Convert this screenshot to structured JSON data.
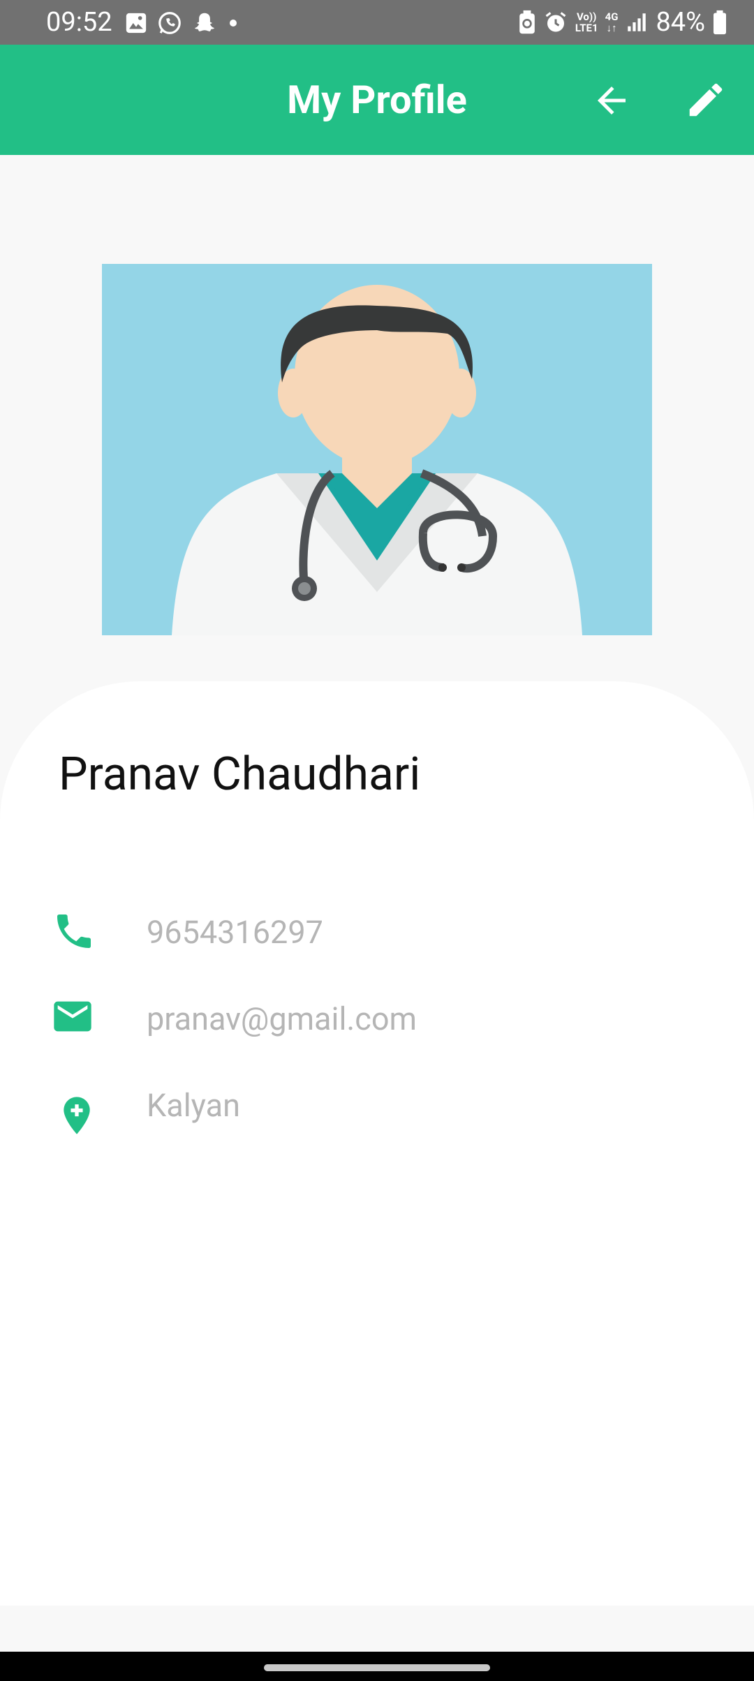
{
  "status_bar": {
    "time": "09:52",
    "network_top": "Vo))",
    "network_bottom": "LTE1",
    "network_type": "4G",
    "battery_percent": "84%",
    "icons": [
      "gallery-icon",
      "whatsapp-icon",
      "snapchat-icon",
      "dot-icon",
      "battery-saver-icon",
      "alarm-icon",
      "signal-icon",
      "battery-icon"
    ]
  },
  "app_bar": {
    "title": "My Profile",
    "background_color": "#22bf86",
    "actions": [
      "back-arrow-icon",
      "edit-pencil-icon"
    ]
  },
  "profile": {
    "avatar": "doctor-avatar-illustration",
    "name": "Pranav Chaudhari",
    "phone": "9654316297",
    "email": "pranav@gmail.com",
    "location": "Kalyan",
    "accent_color": "#22bf86"
  }
}
